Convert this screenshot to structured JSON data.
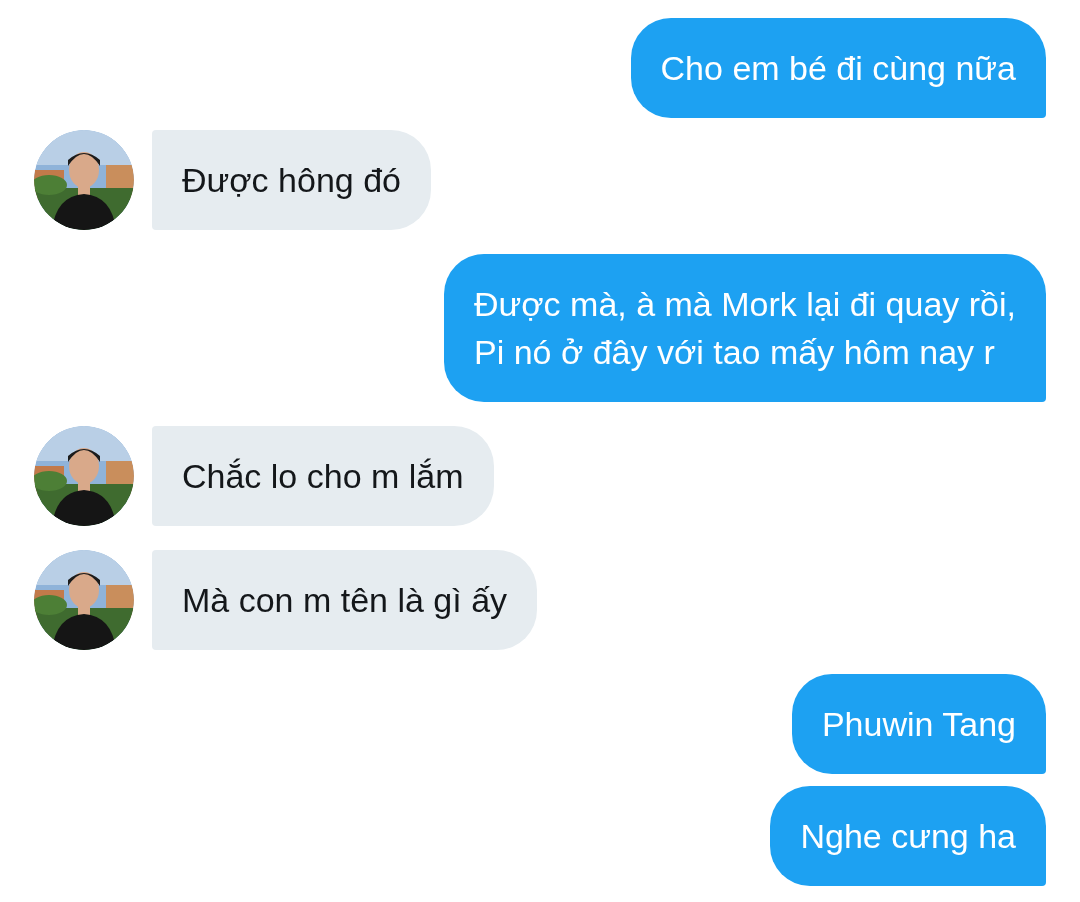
{
  "messages": [
    {
      "kind": "outgoing",
      "text": "Cho em bé đi cùng nữa"
    },
    {
      "kind": "incoming",
      "text": "Được hông đó"
    },
    {
      "kind": "outgoing",
      "text": "Được mà, à mà Mork lại đi quay rồi,\nPi nó ở đây với tao mấy hôm nay r"
    },
    {
      "kind": "incoming",
      "text": "Chắc lo cho m lắm"
    },
    {
      "kind": "incoming",
      "text": "Mà con m tên là gì ấy"
    },
    {
      "kind": "outgoing",
      "text": "Phuwin Tang"
    },
    {
      "kind": "outgoing",
      "text": "Nghe cưng ha"
    }
  ]
}
